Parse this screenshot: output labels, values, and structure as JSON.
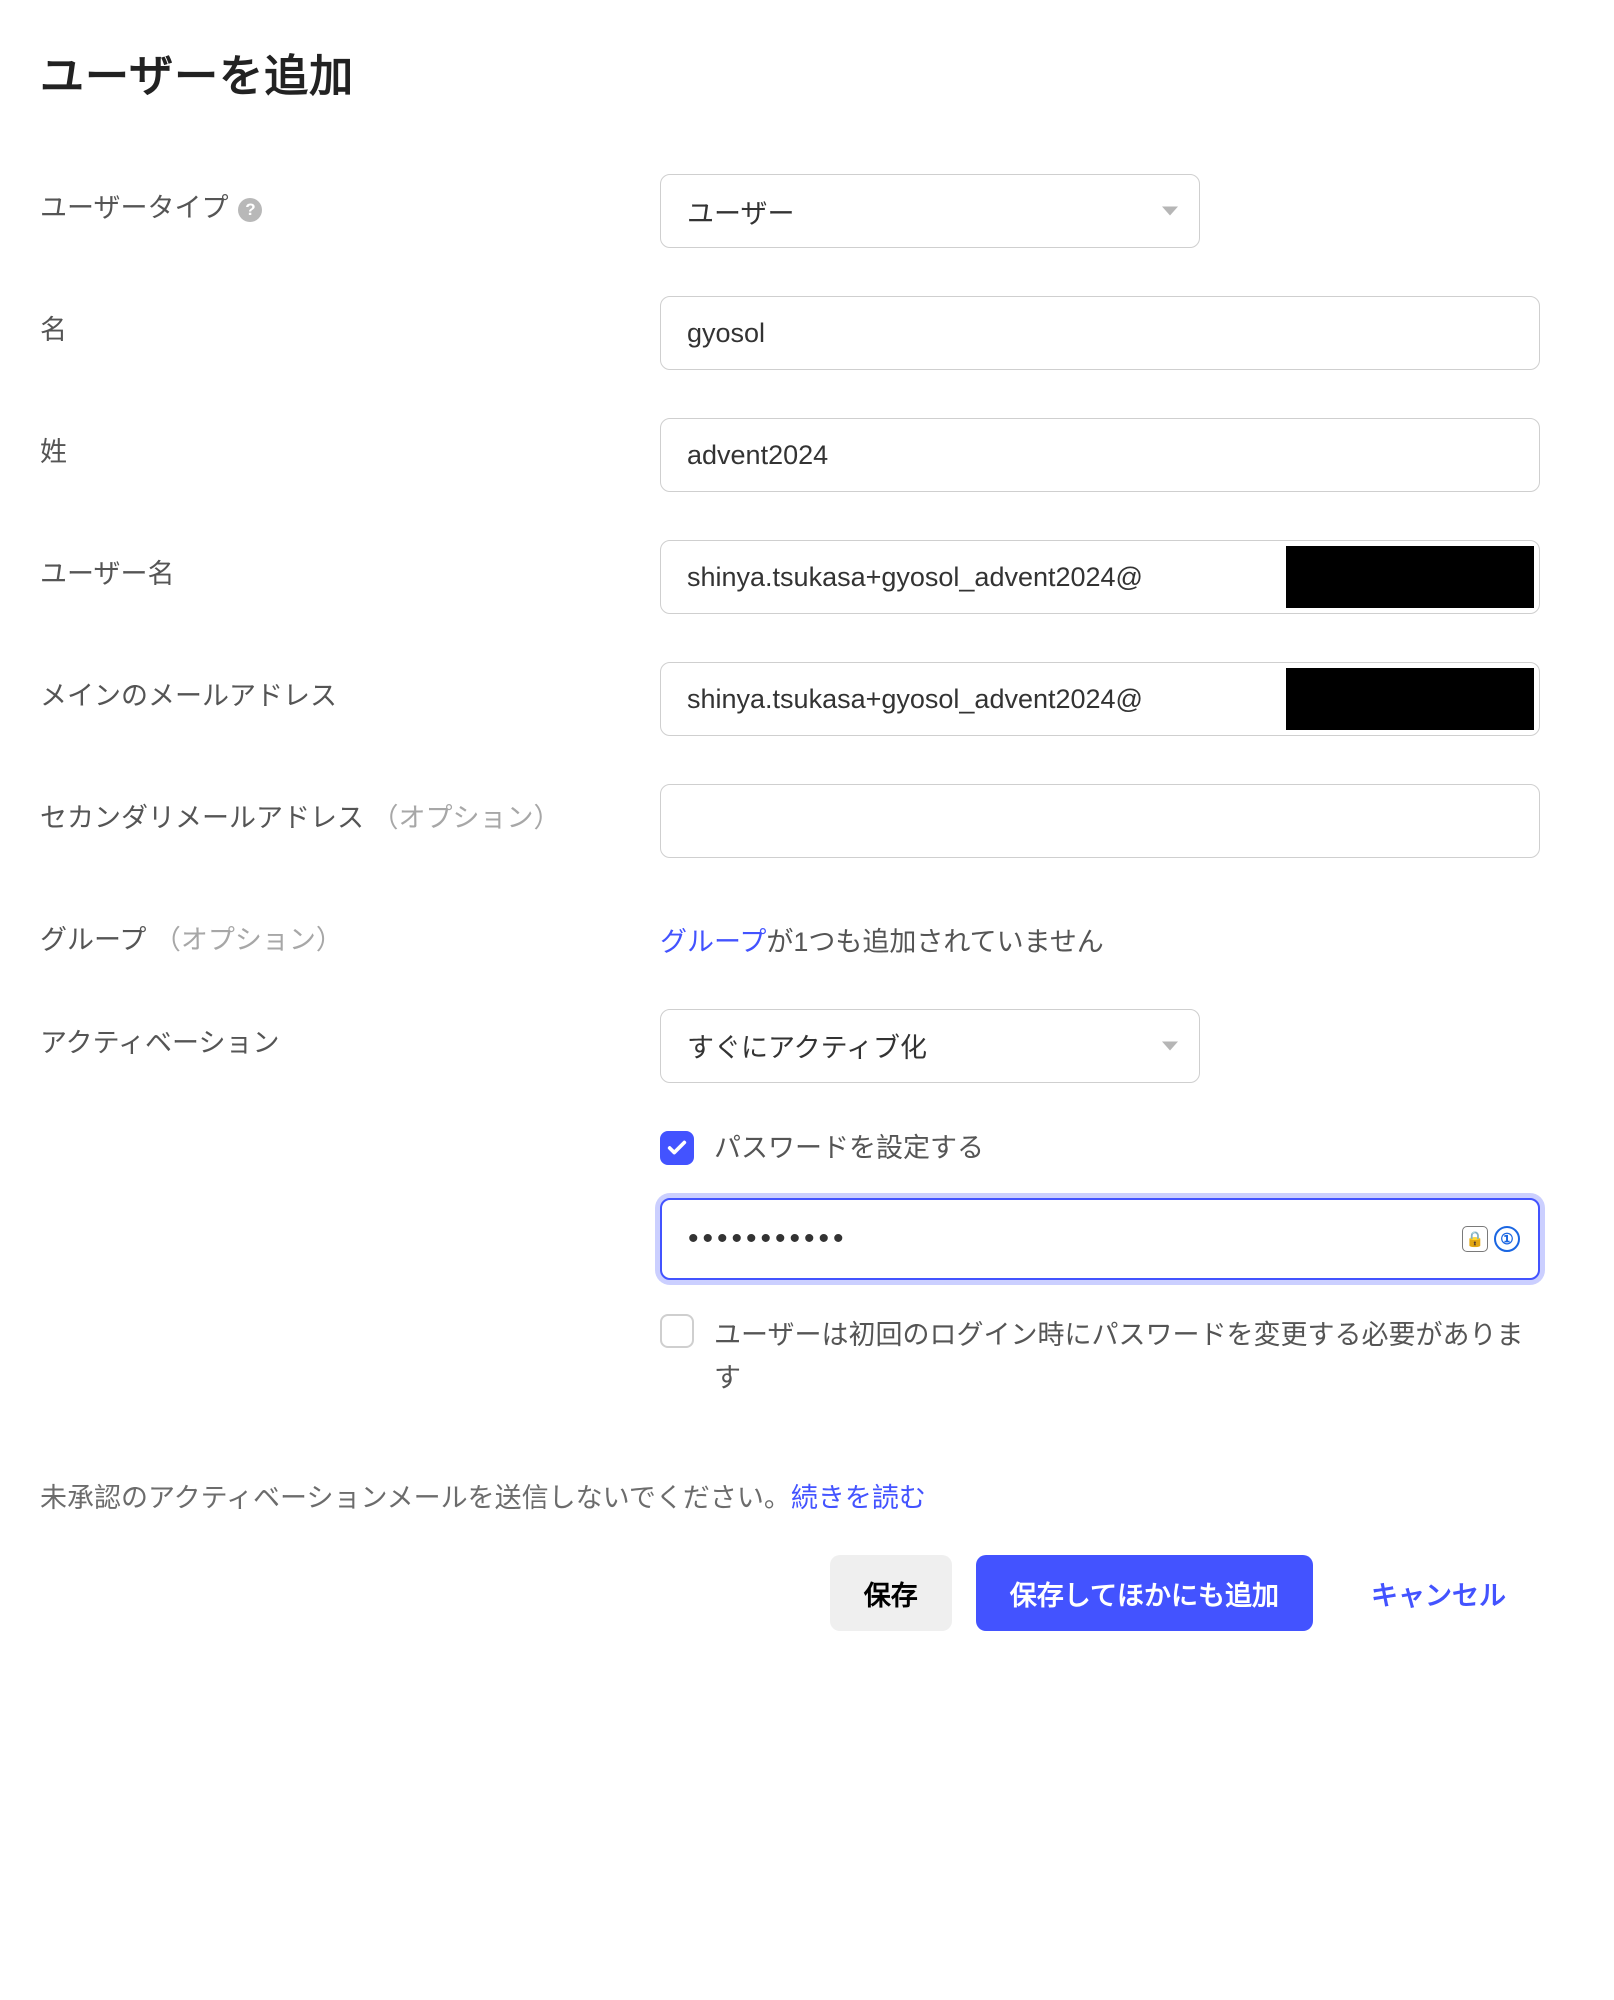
{
  "title": "ユーザーを追加",
  "labels": {
    "user_type": "ユーザータイプ",
    "first_name": "名",
    "last_name": "姓",
    "username": "ユーザー名",
    "primary_email": "メインのメールアドレス",
    "secondary_email": "セカンダリメールアドレス",
    "optional": "（オプション）",
    "groups": "グループ",
    "activation": "アクティベーション"
  },
  "values": {
    "user_type_select": "ユーザー",
    "first_name": "gyosol",
    "last_name": "advent2024",
    "username": "shinya.tsukasa+gyosol_advent2024@",
    "primary_email": "shinya.tsukasa+gyosol_advent2024@",
    "secondary_email": "",
    "activation_select": "すぐにアクティブ化",
    "password": "•••••••••••"
  },
  "groups": {
    "link_text": "グループ",
    "rest": "が1つも追加されていません"
  },
  "checkboxes": {
    "set_password": "パスワードを設定する",
    "require_change": "ユーザーは初回のログイン時にパスワードを変更する必要があります"
  },
  "footer": {
    "note": "未承認のアクティベーションメールを送信しないでください。",
    "read_more": "続きを読む"
  },
  "buttons": {
    "save": "保存",
    "save_and_add": "保存してほかにも追加",
    "cancel": "キャンセル"
  }
}
